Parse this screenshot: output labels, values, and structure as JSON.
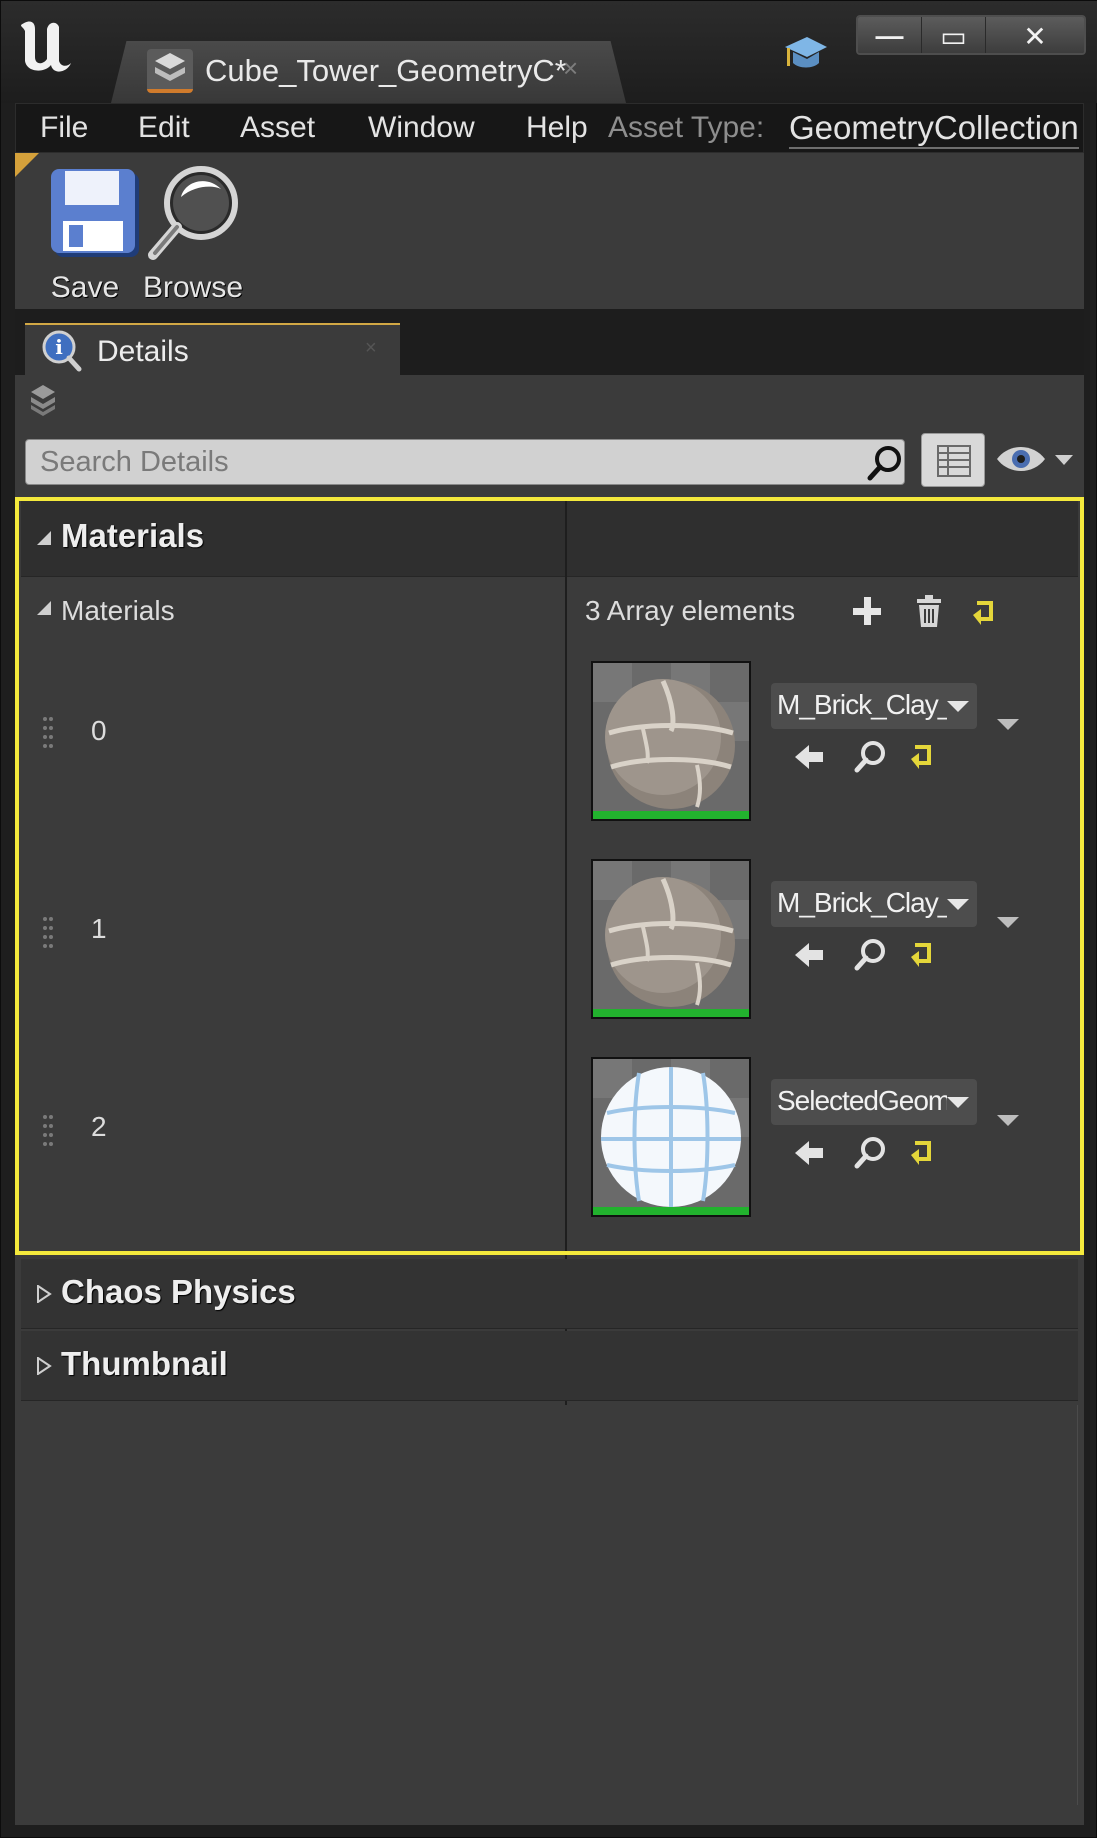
{
  "window": {
    "tab_title": "Cube_Tower_GeometryC*",
    "tab_close_glyph": "×",
    "buttons": {
      "minimize": "—",
      "maximize": "▭",
      "close": "✕"
    }
  },
  "menu": {
    "items": [
      "File",
      "Edit",
      "Asset",
      "Window",
      "Help"
    ],
    "asset_type_label": "Asset Type:",
    "asset_type_value": "GeometryCollection"
  },
  "toolbar": {
    "save_label": "Save",
    "browse_label": "Browse"
  },
  "details_tab": {
    "label": "Details",
    "close_glyph": "×"
  },
  "search": {
    "placeholder": "Search Details"
  },
  "categories": {
    "materials": "Materials",
    "chaos_physics": "Chaos Physics",
    "thumbnail": "Thumbnail"
  },
  "materials_array": {
    "name": "Materials",
    "count_label": "3 Array elements",
    "elements": [
      {
        "index": "0",
        "value": "M_Brick_Clay_"
      },
      {
        "index": "1",
        "value": "M_Brick_Clay_"
      },
      {
        "index": "2",
        "value": "SelectedGeom"
      }
    ]
  },
  "colors": {
    "accent_selection": "#f4e93c",
    "thumbnail_bar": "#22b22e",
    "reset_arrow": "#e4d63a",
    "tab_highlight": "#d2a845"
  },
  "icons": {
    "logo": "unreal-logo-icon",
    "doc_tab": "geometry-collection-icon",
    "tutorial": "graduation-cap-icon",
    "save": "floppy-disk-icon",
    "browse": "magnifier-icon",
    "details": "info-magnifier-icon",
    "search": "search-icon",
    "view_options": "list-view-icon",
    "visibility": "eye-icon",
    "add": "plus-icon",
    "delete": "trash-icon",
    "reset": "reset-arrow-icon",
    "use_selected": "arrow-left-icon",
    "find": "magnifier-icon"
  }
}
